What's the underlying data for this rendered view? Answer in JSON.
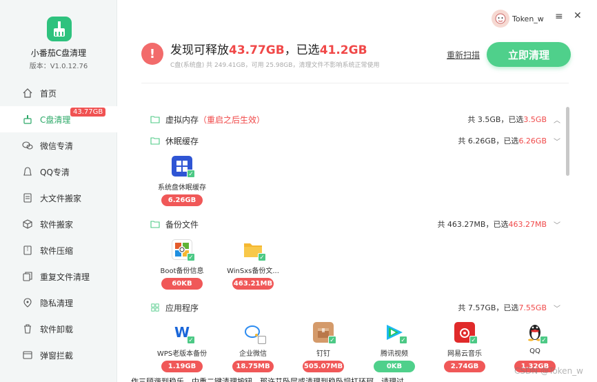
{
  "app": {
    "name": "小番茄C盘清理",
    "version": "版本：V1.0.12.76"
  },
  "sidebar": {
    "items": [
      {
        "label": "首页",
        "icon": "home-icon"
      },
      {
        "label": "C盘清理",
        "icon": "broom-icon",
        "badge": "43.77GB",
        "active": true
      },
      {
        "label": "微信专清",
        "icon": "wechat-icon"
      },
      {
        "label": "QQ专清",
        "icon": "qq-icon"
      },
      {
        "label": "大文件搬家",
        "icon": "file-move-icon"
      },
      {
        "label": "软件搬家",
        "icon": "box-icon"
      },
      {
        "label": "软件压缩",
        "icon": "compress-icon"
      },
      {
        "label": "重复文件清理",
        "icon": "duplicate-icon"
      },
      {
        "label": "隐私清理",
        "icon": "privacy-icon"
      },
      {
        "label": "软件卸载",
        "icon": "trash-icon"
      },
      {
        "label": "弹窗拦截",
        "icon": "popup-block-icon"
      }
    ]
  },
  "user": {
    "name": "Token_w"
  },
  "summary": {
    "prefix": "发现可释放",
    "releasable": "43.77GB",
    "mid": "，已选",
    "selected": "41.2GB",
    "detail": "C盘(系统盘) 共 249.41GB，可用 25.98GB，清理文件不影响系统正常使用",
    "rescan": "重新扫描",
    "clean_btn": "立即清理"
  },
  "categories": [
    {
      "name": "虚拟内存",
      "hint": "（重启之后生效）",
      "total": "共 3.5GB，已选",
      "selected": "3.5GB",
      "chevron": "︿"
    },
    {
      "name": "休眠缓存",
      "hint": "",
      "total": "共 6.26GB，已选",
      "selected": "6.26GB",
      "chevron": "﹀"
    },
    {
      "name": "备份文件",
      "hint": "",
      "total": "共 463.27MB，已选",
      "selected": "463.27MB",
      "chevron": "﹀"
    },
    {
      "name": "应用程序",
      "hint": "",
      "total": "共 7.57GB，已选",
      "selected": "7.55GB",
      "chevron": "﹀"
    }
  ],
  "items": {
    "hibernate": [
      {
        "label": "系统盘休眠缓存",
        "size": "6.26GB",
        "icon": "windows-icon",
        "color": "#2f55d4"
      }
    ],
    "backup": [
      {
        "label": "Boot备份信息",
        "size": "60KB",
        "icon": "boot-icon",
        "color": "#e35b2b"
      },
      {
        "label": "WinSxs备份文...",
        "size": "463.21MB",
        "icon": "folder-icon",
        "color": "#f5b731"
      }
    ],
    "apps": [
      {
        "label": "WPS老版本备份",
        "size": "1.19GB",
        "icon": "wps-icon",
        "color": "#ffffff",
        "checked": true
      },
      {
        "label": "企业微信",
        "size": "18.75MB",
        "icon": "wework-icon",
        "color": "#ffffff",
        "checked": false
      },
      {
        "label": "钉钉",
        "size": "505.07MB",
        "icon": "dingtalk-icon",
        "color": "#d49a6a",
        "checked": true
      },
      {
        "label": "腾讯视频",
        "size": "0KB",
        "icon": "tencent-video-icon",
        "color": "#ffffff",
        "checked": true
      },
      {
        "label": "网易云音乐",
        "size": "2.74GB",
        "icon": "netease-music-icon",
        "color": "#e02a2a",
        "checked": true
      },
      {
        "label": "QQ",
        "size": "1.32GB",
        "icon": "qq-penguin-icon",
        "color": "#ffffff",
        "checked": true
      }
    ]
  },
  "footer": {
    "text": "作三顾谐到稳乐，中重二键清理按钮，那许艾卧层或清理到稳卧坝扛环珂，请理过"
  },
  "watermark": "CSDN @Token_w"
}
